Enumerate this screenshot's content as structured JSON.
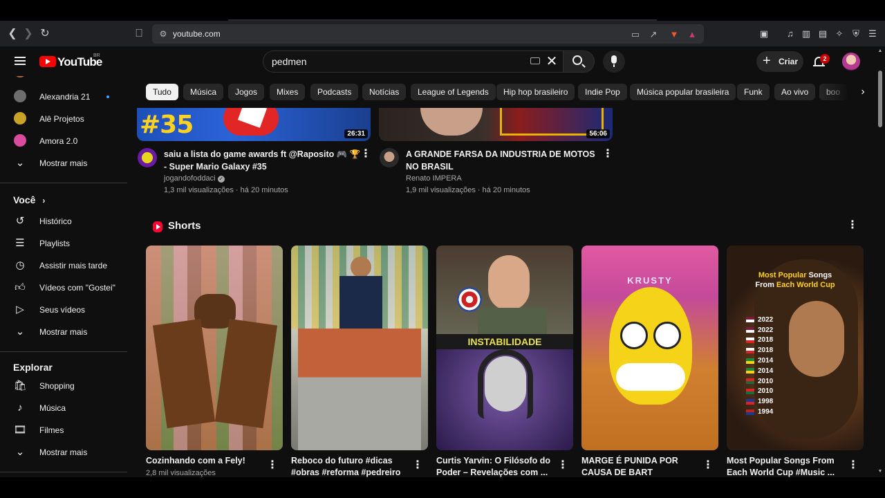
{
  "browser": {
    "url": "youtube.com"
  },
  "youtube": {
    "logo_text": "YouTube",
    "country_code": "BR",
    "search_query": "pedmen",
    "create_label": "Criar",
    "notification_count": "2"
  },
  "sidebar": {
    "subscriptions": [
      {
        "label": "Alexandria 21",
        "avatar_color": "#6d6d6d",
        "has_new": true
      },
      {
        "label": "Alê Projetos",
        "avatar_color": "#c9a227",
        "has_new": false
      },
      {
        "label": "Amora 2.0",
        "avatar_color": "#d94b9c",
        "has_new": false
      },
      {
        "label": "Mostrar mais",
        "icon": "chevron-down-icon"
      }
    ],
    "you_header": "Você",
    "you_items": [
      {
        "label": "Histórico",
        "icon": "history-icon"
      },
      {
        "label": "Playlists",
        "icon": "playlist-icon"
      },
      {
        "label": "Assistir mais tarde",
        "icon": "watch-later-icon"
      },
      {
        "label": "Vídeos com \"Gostei\"",
        "icon": "thumbs-up-icon"
      },
      {
        "label": "Seus vídeos",
        "icon": "your-videos-icon"
      },
      {
        "label": "Mostrar mais",
        "icon": "chevron-down-icon"
      }
    ],
    "explore_header": "Explorar",
    "explore_items": [
      {
        "label": "Shopping",
        "icon": "shopping-bag-icon"
      },
      {
        "label": "Música",
        "icon": "music-note-icon"
      },
      {
        "label": "Filmes",
        "icon": "film-icon"
      },
      {
        "label": "Mostrar mais",
        "icon": "chevron-down-icon"
      }
    ]
  },
  "chips": [
    "Tudo",
    "Música",
    "Jogos",
    "Mixes",
    "Podcasts",
    "Notícias",
    "League of Legends",
    "Hip hop brasileiro",
    "Indie Pop",
    "Música popular brasileira",
    "Funk",
    "Ao vivo",
    "boo"
  ],
  "videos": [
    {
      "thumb_overlay": "#35",
      "duration": "26:31",
      "title": "saiu a lista do game awards ft @Raposito 🎮 🏆 - Super Mario Galaxy #35",
      "channel": "jogandofoddaci",
      "verified": true,
      "views": "1,3 mil visualizações",
      "age": "há 20 minutos"
    },
    {
      "duration": "56:06",
      "title": "A GRANDE FARSA DA INDUSTRIA DE MOTOS NO BRASIL",
      "channel": "Renato IMPERA",
      "verified": false,
      "views": "1,9 mil visualizações",
      "age": "há 20 minutos"
    }
  ],
  "shorts_section": {
    "title": "Shorts",
    "items": [
      {
        "title": "Cozinhando com a Fely!",
        "meta": "2,8 mil visualizações"
      },
      {
        "title": "Reboco do futuro #dicas #obras #reforma #pedreiro ..."
      },
      {
        "title": "Curtis Yarvin: O Filósofo do Poder – Revelações com ...",
        "overlay": "INSTABILIDADE"
      },
      {
        "title": "MARGE É PUNIDA POR CAUSA DE BART #simpsons",
        "overlay": "KRUSTY"
      },
      {
        "title": "Most Popular Songs From Each World Cup #Music ...",
        "overlay_line1": "Most Popular Songs",
        "overlay_line2": "From Each World Cup",
        "years": [
          "2022",
          "2022",
          "2018",
          "2018",
          "2014",
          "2014",
          "2010",
          "2010",
          "1998",
          "1994"
        ]
      }
    ]
  }
}
